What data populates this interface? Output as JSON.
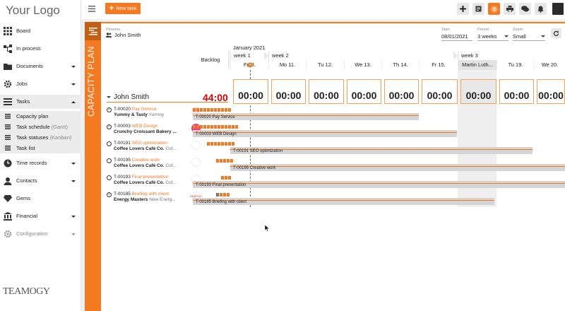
{
  "app": {
    "logo_text": "Your Logo",
    "brand": "TEAMOGY",
    "accent": "#f47920"
  },
  "sidebar": {
    "items": [
      {
        "label": "Board",
        "icon": "grid-icon"
      },
      {
        "label": "In process",
        "icon": "flow-icon"
      },
      {
        "label": "Documents",
        "icon": "folder-icon"
      },
      {
        "label": "Jobs",
        "icon": "gear-icon"
      },
      {
        "label": "Tasks",
        "icon": "list-icon"
      },
      {
        "label": "Time records",
        "icon": "clock-icon"
      },
      {
        "label": "Contacts",
        "icon": "user-icon"
      },
      {
        "label": "Gems",
        "icon": "gem-icon"
      },
      {
        "label": "Financial",
        "icon": "bank-icon"
      },
      {
        "label": "Configuration",
        "icon": "settings-icon"
      }
    ],
    "task_subitems": [
      {
        "label": "Capacity plan",
        "hint": ""
      },
      {
        "label": "Task schedule",
        "hint": "(Gantt)"
      },
      {
        "label": "Task statuses",
        "hint": "(Kanban)"
      },
      {
        "label": "Task list",
        "hint": ""
      }
    ]
  },
  "topbar": {
    "new_task_label": "New task",
    "icons": [
      "plus-icon",
      "note-icon",
      "help-icon",
      "print-icon",
      "chat-icon",
      "bell-icon",
      "grid-menu-icon"
    ]
  },
  "capacity": {
    "strip_title": "CAPACITY PLAN",
    "persons_label": "Persons",
    "persons_value": "John Smith",
    "start_label": "Start",
    "start_value": "08/01/2021",
    "period_label": "Period",
    "period_value": "3 weeks",
    "zoom_label": "Zoom",
    "zoom_value": "Small"
  },
  "timeline": {
    "backlog": "Backlog",
    "month": "January 2021",
    "weeks": [
      "week 1",
      "week 2",
      "week 3"
    ],
    "days": [
      {
        "label": "Fri 8.",
        "gray": false
      },
      {
        "label": "Mo 11.",
        "gray": false
      },
      {
        "label": "Tu 12.",
        "gray": false
      },
      {
        "label": "We 13.",
        "gray": false
      },
      {
        "label": "Th 14.",
        "gray": false
      },
      {
        "label": "Fr 15.",
        "gray": false
      },
      {
        "label": "Martin Luth...",
        "gray": true
      },
      {
        "label": "Tu 19.",
        "gray": false
      },
      {
        "label": "We 20.",
        "gray": false
      }
    ]
  },
  "person": {
    "name": "John Smith",
    "total": "44:00",
    "day_hours": [
      "00:00",
      "00:00",
      "00:00",
      "00:00",
      "00:00",
      "00:00",
      "00:00",
      "00:00",
      "00:00"
    ]
  },
  "tasks": [
    {
      "id": "T-00020",
      "name": "Pay Service",
      "customer": "Yummy & Tasty",
      "project": "Yummy",
      "bar_label": "T-00020 Pay Service",
      "done": true,
      "logo": "cake"
    },
    {
      "id": "T-00003",
      "name": "WEB Design",
      "customer": "Crunchy Croissant Bakery ...",
      "project": "",
      "bar_label": "T-00003 WEB Design",
      "done": true,
      "logo": "croissant"
    },
    {
      "id": "T-00191",
      "name": "SEO optimization",
      "customer": "Coffee Lovers Café Co.",
      "project": "Cof...",
      "bar_label": "T-00191 SEO optimization",
      "done": false,
      "logo": "coffee"
    },
    {
      "id": "T-00195",
      "name": "Creative work",
      "customer": "Coffee Lovers Café Co.",
      "project": "Cof...",
      "bar_label": "T-00195 Creative work",
      "done": false,
      "logo": "coffee"
    },
    {
      "id": "T-00193",
      "name": "Final presentation",
      "customer": "Coffee Lovers Café Co.",
      "project": "Cof...",
      "bar_label": "T-00193 Final presentation",
      "done": false,
      "logo": "coffee"
    },
    {
      "id": "T-00185",
      "name": "Briefing with client",
      "customer": "Energy Masters",
      "project": "New Energ...",
      "bar_label": "T-00185 Briefing with client",
      "done": true,
      "logo": "energy"
    }
  ],
  "logo_texts": {
    "energy": "ENERGY"
  }
}
